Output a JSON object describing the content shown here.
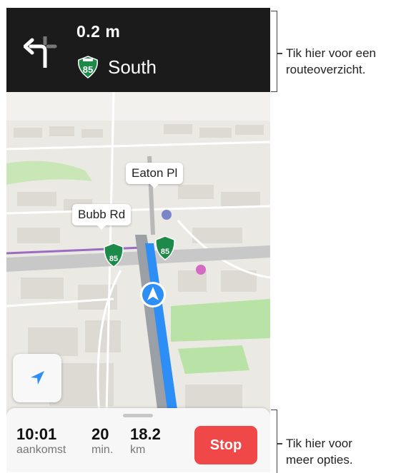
{
  "navigation": {
    "distance": "0.2 m",
    "route_number": "85",
    "road_name": "South",
    "turn_direction": "left-turn-icon"
  },
  "map": {
    "labels": [
      "Eaton Pl",
      "Bubb Rd"
    ],
    "highway_shields": [
      "85",
      "85"
    ],
    "colors": {
      "route": "#2d8ef5",
      "park": "#b8e2a6",
      "highway": "#9aa0a6",
      "banner": "#1b1b1b"
    }
  },
  "trip": {
    "arrival_time": "10:01",
    "arrival_label": "aankomst",
    "duration": "20",
    "duration_unit": "min.",
    "distance": "18.2",
    "distance_unit": "km",
    "stop_label": "Stop",
    "stop_color": "#f04848"
  },
  "callouts": {
    "top": "Tik hier voor een routeoverzicht.",
    "top_line1": "Tik hier voor een",
    "top_line2": "routeoverzicht.",
    "bottom_line1": "Tik hier voor",
    "bottom_line2": "meer opties."
  }
}
